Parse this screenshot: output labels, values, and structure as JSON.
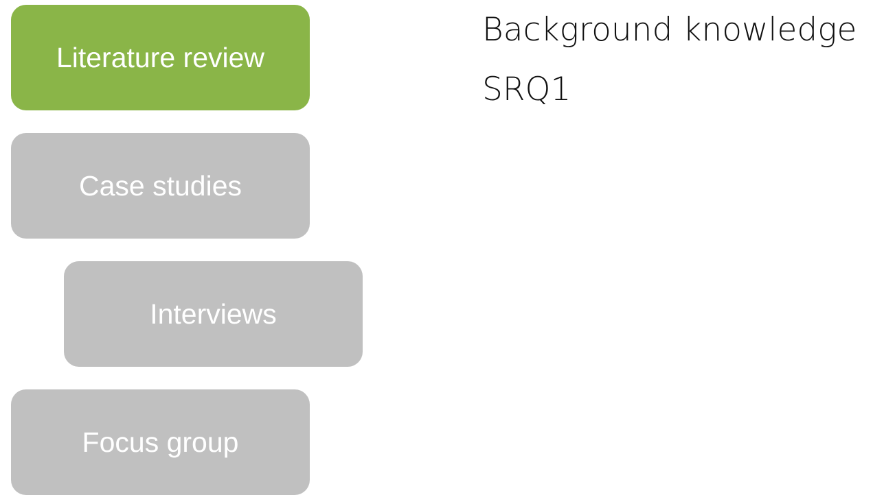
{
  "colors": {
    "active": "#8ab548",
    "inactive": "#c0c0c0",
    "text_on_box": "#ffffff",
    "side_text": "#111111"
  },
  "steps": [
    {
      "label": "Literature review",
      "state": "active"
    },
    {
      "label": "Case studies",
      "state": "inactive"
    },
    {
      "label": "Interviews",
      "state": "inactive"
    },
    {
      "label": "Focus group",
      "state": "inactive"
    }
  ],
  "details": [
    "Background knowledge",
    "SRQ1"
  ]
}
